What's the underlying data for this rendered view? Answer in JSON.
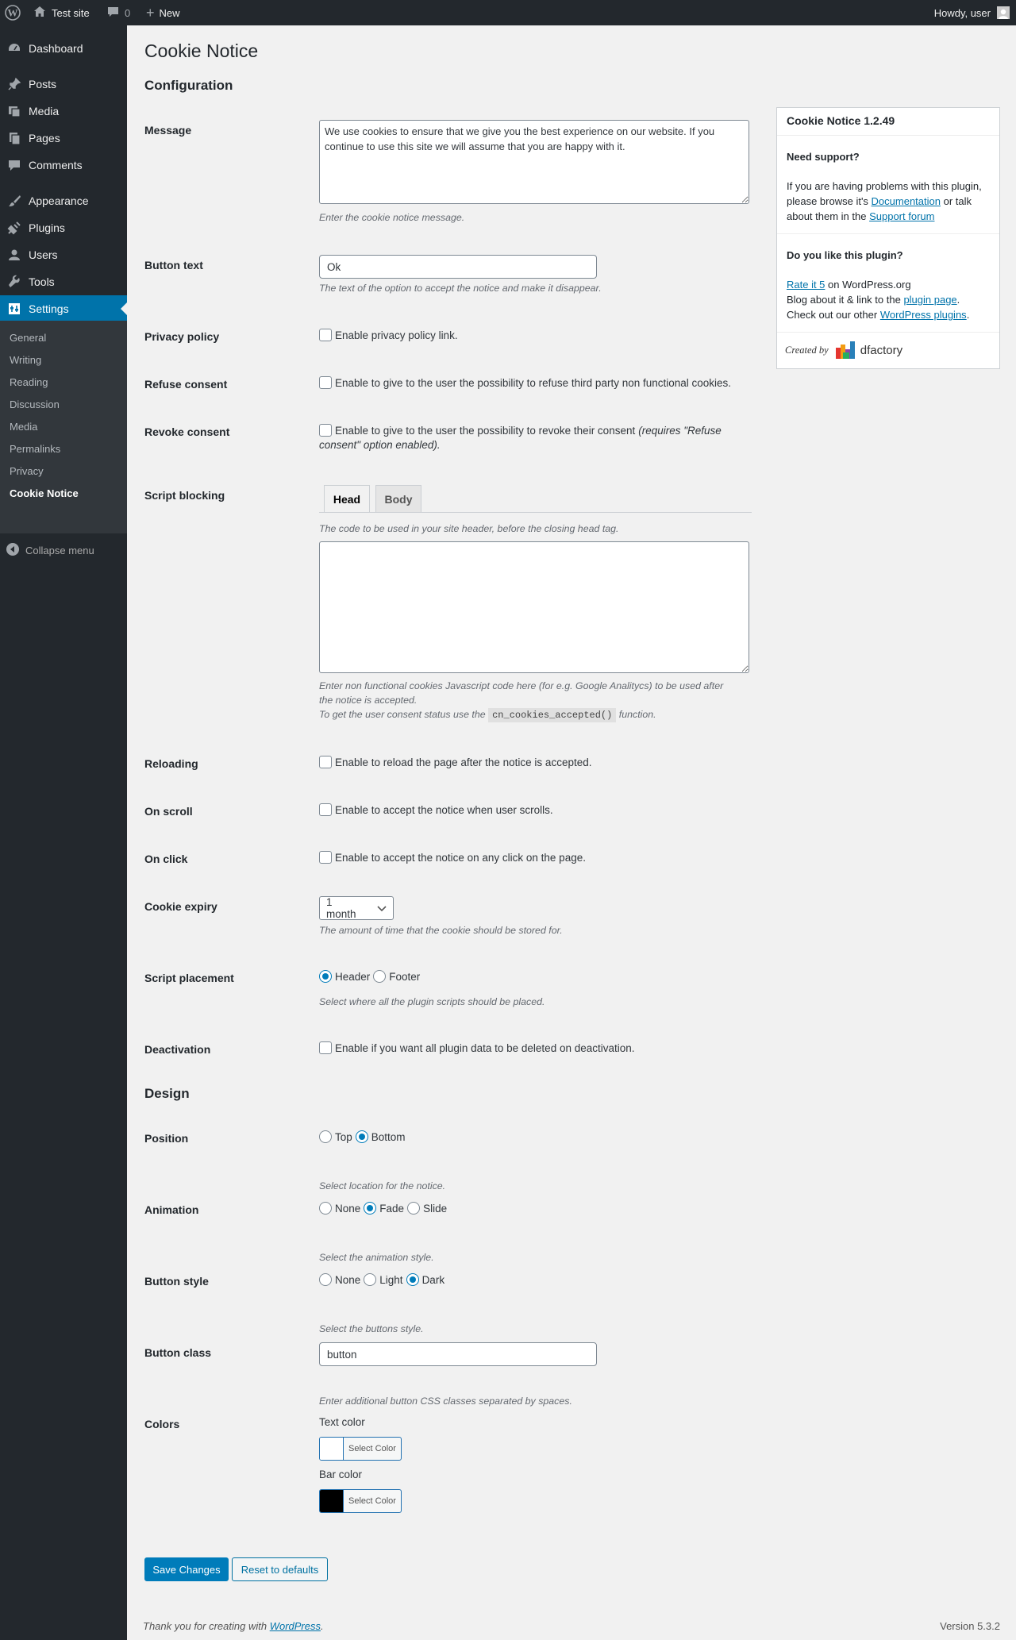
{
  "adminbar": {
    "site_name": "Test site",
    "comments_count": "0",
    "new_label": "New",
    "howdy": "Howdy, user"
  },
  "sidebar": {
    "items": [
      {
        "label": "Dashboard",
        "icon": "dashboard-icon"
      },
      {
        "label": "Posts",
        "icon": "pin-icon"
      },
      {
        "label": "Media",
        "icon": "media-icon"
      },
      {
        "label": "Pages",
        "icon": "pages-icon"
      },
      {
        "label": "Comments",
        "icon": "comment-icon"
      },
      {
        "label": "Appearance",
        "icon": "brush-icon"
      },
      {
        "label": "Plugins",
        "icon": "plugin-icon"
      },
      {
        "label": "Users",
        "icon": "user-icon"
      },
      {
        "label": "Tools",
        "icon": "wrench-icon"
      },
      {
        "label": "Settings",
        "icon": "settings-icon"
      }
    ],
    "submenu": [
      "General",
      "Writing",
      "Reading",
      "Discussion",
      "Media",
      "Permalinks",
      "Privacy",
      "Cookie Notice"
    ],
    "collapse_label": "Collapse menu"
  },
  "page": {
    "title": "Cookie Notice",
    "configuration_title": "Configuration",
    "design_title": "Design"
  },
  "fields": {
    "message": {
      "label": "Message",
      "value": "We use cookies to ensure that we give you the best experience on our website. If you continue to use this site we will assume that you are happy with it.",
      "desc": "Enter the cookie notice message."
    },
    "button_text": {
      "label": "Button text",
      "value": "Ok",
      "desc": "The text of the option to accept the notice and make it disappear."
    },
    "privacy_policy": {
      "label": "Privacy policy",
      "option": "Enable privacy policy link."
    },
    "refuse_consent": {
      "label": "Refuse consent",
      "option": "Enable to give to the user the possibility to refuse third party non functional cookies."
    },
    "revoke_consent": {
      "label": "Revoke consent",
      "option": "Enable to give to the user the possibility to revoke their consent",
      "option_note_1": "(requires \"Refuse",
      "option_note_2": "consent\" option enabled)."
    },
    "script_blocking": {
      "label": "Script blocking",
      "tabs": [
        "Head",
        "Body"
      ],
      "tab_desc": "The code to be used in your site header, before the closing head tag.",
      "value": "",
      "desc_line1": "Enter non functional cookies Javascript code here (for e.g. Google Analitycs) to be used after",
      "desc_line2": "the notice is accepted.",
      "desc_line3_pre": "To get the user consent status use the",
      "desc_code": "cn_cookies_accepted()",
      "desc_line3_post": "function."
    },
    "reloading": {
      "label": "Reloading",
      "option": "Enable to reload the page after the notice is accepted."
    },
    "on_scroll": {
      "label": "On scroll",
      "option": "Enable to accept the notice when user scrolls."
    },
    "on_click": {
      "label": "On click",
      "option": "Enable to accept the notice on any click on the page."
    },
    "cookie_expiry": {
      "label": "Cookie expiry",
      "value": "1 month",
      "desc": "The amount of time that the cookie should be stored for."
    },
    "script_placement": {
      "label": "Script placement",
      "options": [
        "Header",
        "Footer"
      ],
      "selected": "Header",
      "desc": "Select where all the plugin scripts should be placed."
    },
    "deactivation": {
      "label": "Deactivation",
      "option": "Enable if you want all plugin data to be deleted on deactivation."
    },
    "position": {
      "label": "Position",
      "options": [
        "Top",
        "Bottom"
      ],
      "selected": "Bottom",
      "desc": "Select location for the notice."
    },
    "animation": {
      "label": "Animation",
      "options": [
        "None",
        "Fade",
        "Slide"
      ],
      "selected": "Fade",
      "desc": "Select the animation style."
    },
    "button_style": {
      "label": "Button style",
      "options": [
        "None",
        "Light",
        "Dark"
      ],
      "selected": "Dark",
      "desc": "Select the buttons style."
    },
    "button_class": {
      "label": "Button class",
      "value": "button",
      "desc": "Enter additional button CSS classes separated by spaces."
    },
    "colors": {
      "label": "Colors",
      "text_color_label": "Text color",
      "text_color": "#ffffff",
      "bar_color_label": "Bar color",
      "bar_color": "#000000",
      "select_label": "Select Color"
    }
  },
  "actions": {
    "save": "Save Changes",
    "reset": "Reset to defaults"
  },
  "postbox": {
    "title": "Cookie Notice 1.2.49",
    "support_title": "Need support?",
    "support_text_1": "If you are having problems with this plugin,",
    "support_text_2a": "please browse it's",
    "support_link_docs": "Documentation",
    "support_text_2b": "or talk",
    "support_text_3a": "about them in the",
    "support_link_forum": "Support forum",
    "like_title": "Do you like this plugin?",
    "rate_link": "Rate it 5",
    "rate_text": "on WordPress.org",
    "blog_text": "Blog about it & link to the",
    "plugin_page_link": "plugin page",
    "other_text": "Check out our other",
    "other_link": "WordPress plugins",
    "created_by": "Created by",
    "brand": "dfactory"
  },
  "footer": {
    "thanks_pre": "Thank you for creating with",
    "thanks_link": "WordPress",
    "version": "Version 5.3.2"
  },
  "colors": {
    "accent": "#0073aa",
    "sidebar_bg": "#23282d",
    "submenu_bg": "#32373c"
  }
}
